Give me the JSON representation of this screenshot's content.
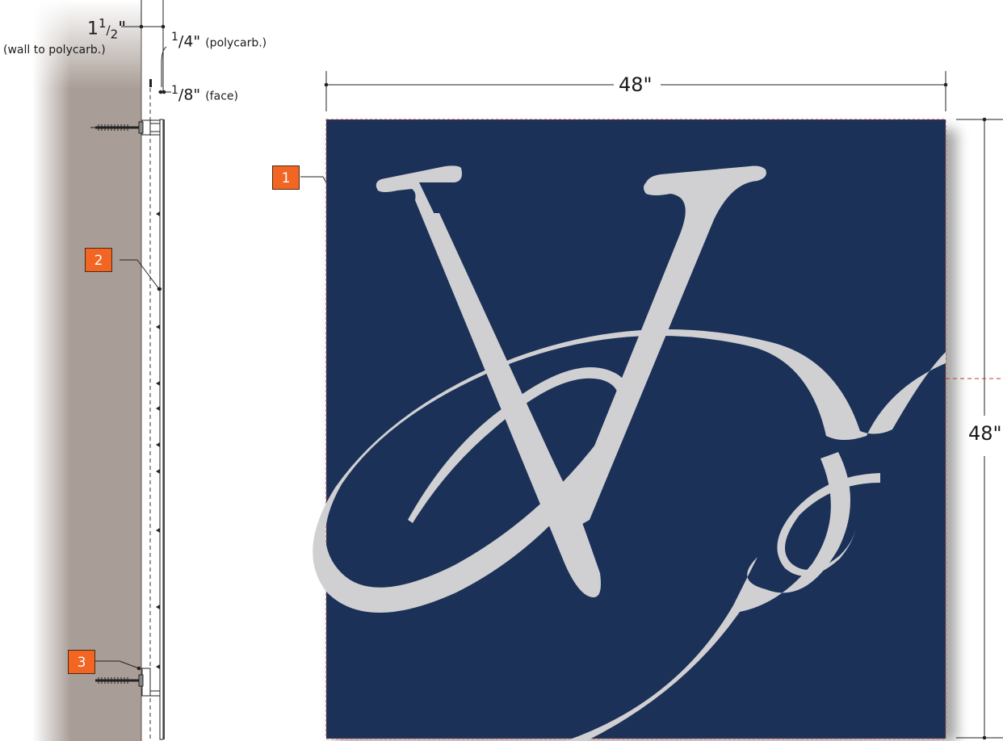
{
  "side_detail": {
    "wall_dim_whole": "1",
    "wall_dim_num": "1",
    "wall_dim_den": "2",
    "wall_dim_unit": "\"",
    "wall_dim_note": "(wall to polycarb.)",
    "poly_dim_num": "1",
    "poly_dim_den": "4",
    "poly_dim_unit": "\"",
    "poly_dim_note": "(polycarb.)",
    "face_dim_num": "1",
    "face_dim_den": "8",
    "face_dim_unit": "\"",
    "face_dim_note": "(face)"
  },
  "front_view": {
    "width_label": "48\"",
    "height_label": "48\"",
    "panel_color": "#1b3158",
    "logo_color": "#d0d0d2"
  },
  "callouts": [
    {
      "number": "1"
    },
    {
      "number": "2"
    },
    {
      "number": "3"
    }
  ],
  "colors": {
    "callout": "#f26522",
    "wall": "#a99e97"
  }
}
